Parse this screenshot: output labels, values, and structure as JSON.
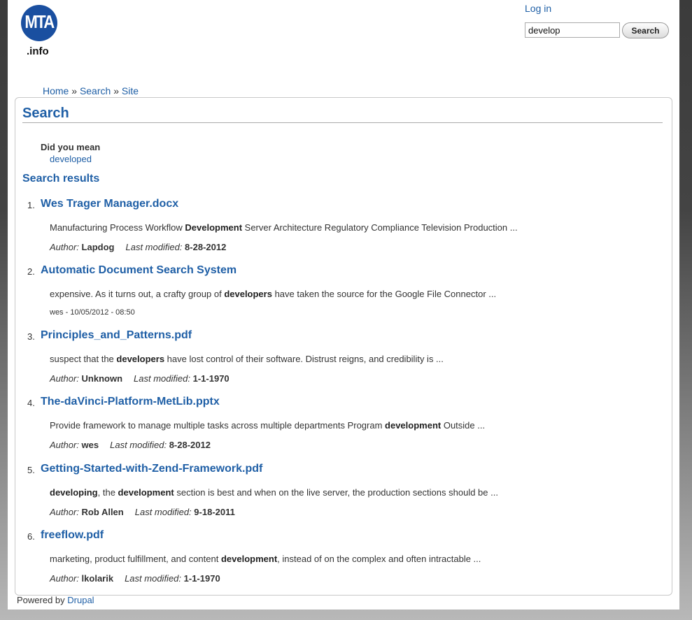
{
  "logo": {
    "mark": "MTA",
    "suffix": ".info"
  },
  "header": {
    "login_label": "Log in",
    "search_value": "develop",
    "search_button": "Search"
  },
  "breadcrumb": {
    "home": "Home",
    "sep1": "»",
    "search": "Search",
    "sep2": "»",
    "site": "Site"
  },
  "main": {
    "title": "Search",
    "did_you_mean_label": "Did you mean",
    "suggestion": "developed",
    "results_heading": "Search results"
  },
  "results": [
    {
      "num": "1.",
      "title": "Wes Trager Manager.docx",
      "snippet_parts": [
        "Manufacturing Process Workflow ",
        "Development",
        " Server Architecture Regulatory Compliance Television Production ..."
      ],
      "author_label": "Author:",
      "author": "Lapdog",
      "modified_label": "Last modified:",
      "modified": "8-28-2012"
    },
    {
      "num": "2.",
      "title": "Automatic Document Search System",
      "snippet_parts": [
        "expensive. As it turns out, a crafty group of ",
        "developers",
        " have taken the source for the Google File Connector ..."
      ],
      "info": "wes - 10/05/2012 - 08:50"
    },
    {
      "num": "3.",
      "title": "Principles_and_Patterns.pdf",
      "snippet_parts": [
        "suspect that the ",
        "developers",
        " have lost control of their software. Distrust reigns, and credibility is ..."
      ],
      "author_label": "Author:",
      "author": "Unknown",
      "modified_label": "Last modified:",
      "modified": "1-1-1970"
    },
    {
      "num": "4.",
      "title": "The-daVinci-Platform-MetLib.pptx",
      "snippet_parts": [
        "Provide framework to manage multiple tasks across multiple departments Program ",
        "development",
        " Outside ..."
      ],
      "author_label": "Author:",
      "author": "wes",
      "modified_label": "Last modified:",
      "modified": "8-28-2012"
    },
    {
      "num": "5.",
      "title": "Getting-Started-with-Zend-Framework.pdf",
      "snippet_parts": [
        "",
        "developing",
        ", the ",
        "development",
        " section is best and when on the live server, the production sections should be ..."
      ],
      "author_label": "Author:",
      "author": "Rob Allen",
      "modified_label": "Last modified:",
      "modified": "9-18-2011"
    },
    {
      "num": "6.",
      "title": "freeflow.pdf",
      "snippet_parts": [
        "marketing, product fulfillment, and content ",
        "development",
        ", instead of on the complex and often intractable ..."
      ],
      "author_label": "Author:",
      "author": "lkolarik",
      "modified_label": "Last modified:",
      "modified": "1-1-1970"
    }
  ],
  "footer": {
    "text": "Powered by ",
    "link": "Drupal"
  }
}
